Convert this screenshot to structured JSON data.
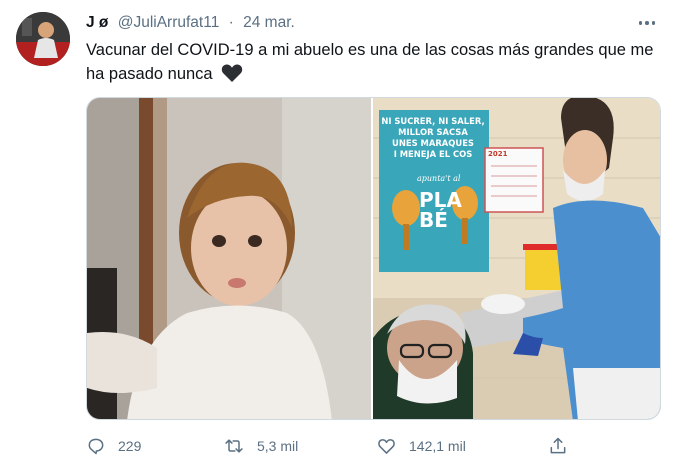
{
  "author": {
    "name": "J ø",
    "handle": "@JuliArrufat11",
    "separator": "·",
    "date": "24 mar."
  },
  "tweet": {
    "text": "Vacunar del COVID-19 a mi abuelo es una de las cosas más grandes que me ha pasado nunca"
  },
  "icons": {
    "more": "more-icon",
    "heart_emoji": "black-heart-emoji",
    "reply": "reply-icon",
    "retweet": "retweet-icon",
    "like": "like-icon",
    "share": "share-icon"
  },
  "media": {
    "poster_lines": [
      "NI SUCRER, NI SALER,",
      "MILLOR SACSA",
      "UNES MARAQUES",
      "I MENEJA EL COS"
    ],
    "poster_sub": "apunta't al",
    "poster_brand_1": "PLA",
    "poster_brand_2": "BÉ",
    "poster_year": "2021"
  },
  "actions": {
    "replies": "229",
    "retweets": "5,3 mil",
    "likes": "142,1 mil"
  },
  "colors": {
    "text": "#0f1419",
    "secondary": "#5b7083",
    "border": "#cfd9de",
    "poster_teal": "#3aa6b9"
  }
}
